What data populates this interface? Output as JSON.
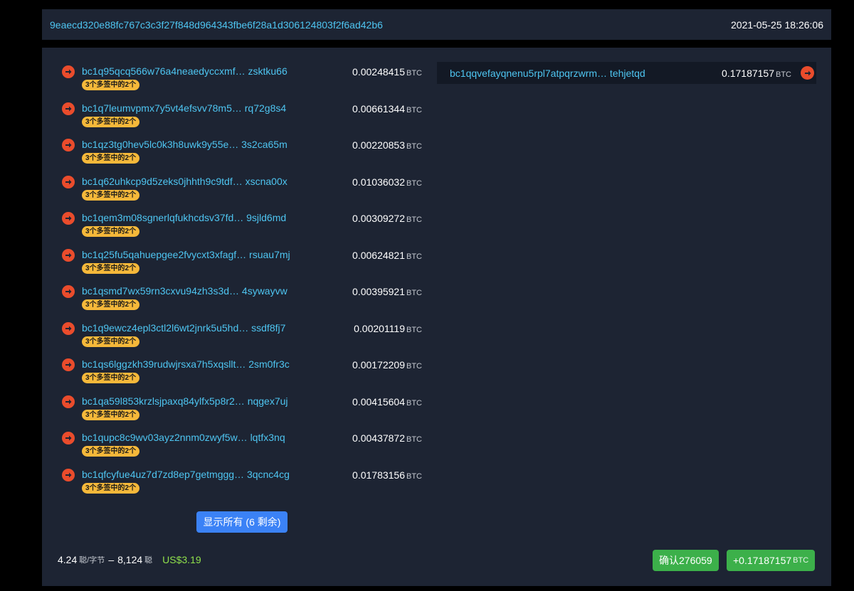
{
  "header": {
    "txid": "9eaecd320e88fc767c3c3f27f848d964343fbe6f28a1d306124803f2f6ad42b6",
    "timestamp": "2021-05-25 18:26:06"
  },
  "inputs": [
    {
      "address": "bc1q95qcq566w76a4neaedyccxmf… zsktku66",
      "amount": "0.00248415",
      "unit": "BTC",
      "badge": "3个多签中的2个"
    },
    {
      "address": "bc1q7leumvpmx7y5vt4efsvv78m5…  rq72g8s4",
      "amount": "0.00661344",
      "unit": "BTC",
      "badge": "3个多签中的2个"
    },
    {
      "address": "bc1qz3tg0hev5lc0k3h8uwk9y55e… 3s2ca65m",
      "amount": "0.00220853",
      "unit": "BTC",
      "badge": "3个多签中的2个"
    },
    {
      "address": "bc1q62uhkcp9d5zeks0jhhth9c9tdf… xscna00x",
      "amount": "0.01036032",
      "unit": "BTC",
      "badge": "3个多签中的2个"
    },
    {
      "address": "bc1qem3m08sgnerlqfukhcdsv37fd…  9sjld6md",
      "amount": "0.00309272",
      "unit": "BTC",
      "badge": "3个多签中的2个"
    },
    {
      "address": "bc1q25fu5qahuepgee2fvycxt3xfagf… rsuau7mj",
      "amount": "0.00624821",
      "unit": "BTC",
      "badge": "3个多签中的2个"
    },
    {
      "address": "bc1qsmd7wx59rn3cxvu94zh3s3d…  4sywayvw",
      "amount": "0.00395921",
      "unit": "BTC",
      "badge": "3个多签中的2个"
    },
    {
      "address": "bc1q9ewcz4epl3ctl2l6wt2jnrk5u5hd… ssdf8fj7",
      "amount": "0.00201119",
      "unit": "BTC",
      "badge": "3个多签中的2个"
    },
    {
      "address": "bc1qs6lggzkh39rudwjrsxa7h5xqsllt… 2sm0fr3c",
      "amount": "0.00172209",
      "unit": "BTC",
      "badge": "3个多签中的2个"
    },
    {
      "address": "bc1qa59l853krzlsjpaxq84ylfx5p8r2… nqgex7uj",
      "amount": "0.00415604",
      "unit": "BTC",
      "badge": "3个多签中的2个"
    },
    {
      "address": "bc1qupc8c9wv03ayz2nnm0zwyf5w…  lqtfx3nq",
      "amount": "0.00437872",
      "unit": "BTC",
      "badge": "3个多签中的2个"
    },
    {
      "address": "bc1qfcyfue4uz7d7zd8ep7getmggg… 3qcnc4cg",
      "amount": "0.01783156",
      "unit": "BTC",
      "badge": "3个多签中的2个"
    }
  ],
  "show_all_label": "显示所有 (6 剩余)",
  "outputs": [
    {
      "address": "bc1qqvefayqnenu5rpl7atpqrzwrm…  tehjetqd",
      "amount": "0.17187157",
      "unit": "BTC"
    }
  ],
  "footer": {
    "fee_rate": "4.24",
    "fee_rate_unit": "聪/字节",
    "separator": "–",
    "fee": "8,124",
    "fee_unit": "聪",
    "usd": "US$3.19",
    "confirmations": "确认276059",
    "total": "+0.17187157",
    "total_unit": "BTC"
  },
  "icons": {
    "input_arrow": "arrow-right-circle-icon",
    "output_arrow": "arrow-right-circle-icon"
  },
  "colors": {
    "link": "#4ec5f1",
    "arrow": "#ea4c2c",
    "badge": "#f5b83a",
    "button_blue": "#3b82f6",
    "button_green": "#3cb04a",
    "usd": "#8fe04b",
    "panel": "#1d2433"
  }
}
